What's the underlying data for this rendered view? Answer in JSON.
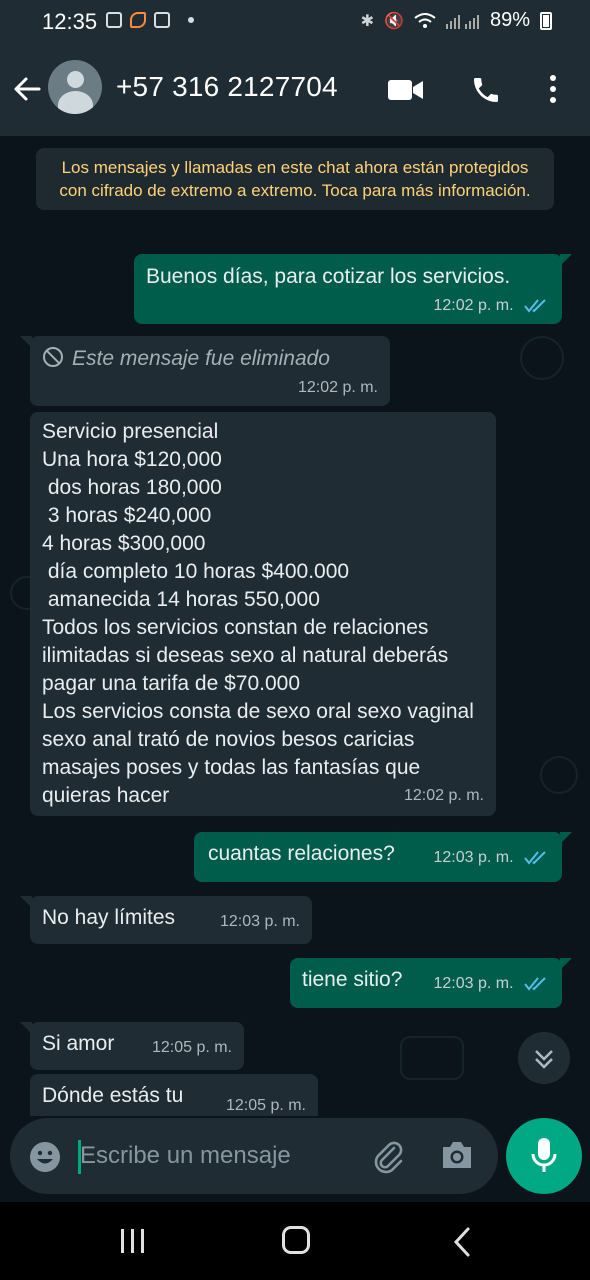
{
  "status_bar": {
    "time": "12:35",
    "battery": "89%"
  },
  "header": {
    "contact": "+57 316 2127704"
  },
  "encryption_notice": "Los mensajes y llamadas en este chat ahora están protegidos con cifrado de extremo a extremo. Toca para más información.",
  "messages": [
    {
      "direction": "out",
      "text": "Buenos días, para cotizar los servicios.",
      "time": "12:02 p. m.",
      "status": "read"
    },
    {
      "direction": "in",
      "text": "Este mensaje fue eliminado",
      "time": "12:02 p. m.",
      "deleted": true
    },
    {
      "direction": "in",
      "text": "Servicio presencial\nUna hora $120,000\n dos horas 180,000\n 3 horas $240,000\n4 horas $300,000\n día completo 10 horas $400.000\n amanecida 14 horas 550,000\nTodos los servicios constan de relaciones ilimitadas si deseas sexo al natural deberás pagar una tarifa de $70.000\nLos servicios consta de sexo oral sexo vaginal sexo anal trató de novios besos caricias masajes poses y todas las fantasías que quieras hacer",
      "time": "12:02 p. m."
    },
    {
      "direction": "out",
      "text": "cuantas relaciones?",
      "time": "12:03 p. m.",
      "status": "read"
    },
    {
      "direction": "in",
      "text": "No hay límites",
      "time": "12:03 p. m."
    },
    {
      "direction": "out",
      "text": "tiene sitio?",
      "time": "12:03 p. m.",
      "status": "read"
    },
    {
      "direction": "in",
      "text": "Si amor",
      "time": "12:05 p. m."
    },
    {
      "direction": "in",
      "text": "Dónde estás tu",
      "time": "12:05 p. m."
    }
  ],
  "composer": {
    "placeholder": "Escribe un mensaje"
  },
  "icons": {
    "back": "arrow-left-icon",
    "video": "video-camera-icon",
    "call": "phone-icon",
    "menu": "more-vertical-icon",
    "emoji": "emoji-icon",
    "attach": "paperclip-icon",
    "camera": "camera-icon",
    "mic": "microphone-icon",
    "scroll": "double-chevron-down-icon",
    "read": "double-check-icon",
    "deleted": "ban-icon"
  },
  "colors": {
    "accent": "#00a884",
    "outgoing": "#005c4b",
    "incoming": "#1f2c33",
    "read_ticks": "#53bdeb",
    "notice_text": "#ffd279",
    "background": "#0b141a"
  }
}
